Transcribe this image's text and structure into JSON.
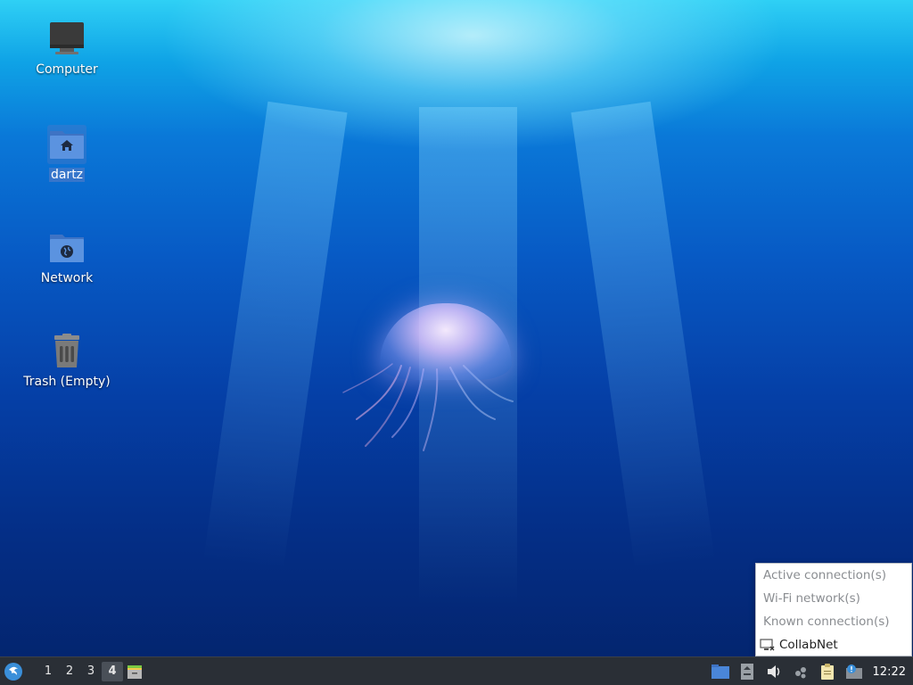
{
  "desktop": {
    "icons": [
      {
        "label": "Computer"
      },
      {
        "label": "dartz"
      },
      {
        "label": "Network"
      },
      {
        "label": "Trash (Empty)"
      }
    ]
  },
  "taskbar": {
    "workspaces": [
      "1",
      "2",
      "3",
      "4"
    ],
    "active_workspace": "4",
    "clock": "12:22",
    "tray_icons": [
      "file-manager-icon",
      "network-disconnected-icon",
      "volume-icon",
      "bluetooth-icon",
      "clipboard-icon",
      "update-notifier-icon"
    ]
  },
  "network_menu": {
    "headers": [
      "Active connection(s)",
      "Wi-Fi network(s)",
      "Known connection(s)"
    ],
    "items": [
      {
        "label": "CollabNet",
        "icon": "wired-disconnected-icon"
      }
    ]
  },
  "colors": {
    "taskbar_bg": "#2a2f36",
    "folder_blue": "#4a86d9",
    "selection": "#4678c8"
  }
}
